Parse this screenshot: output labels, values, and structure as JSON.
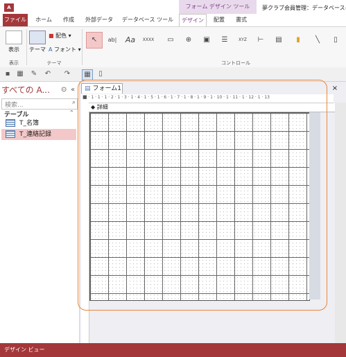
{
  "title_bar": {
    "app_icon": "A",
    "context_header": "フォーム デザイン ツール",
    "doc_title": "夢クラブ会員管理：データベース- C:"
  },
  "tabs": [
    "ファイル",
    "ホーム",
    "作成",
    "外部データ",
    "データベース ツール",
    "デザイン",
    "配置",
    "書式"
  ],
  "ribbon": {
    "group_view": {
      "button": "表示",
      "label": "表示"
    },
    "group_theme": {
      "theme_button": "テーマ",
      "colors": "配色",
      "fonts": "フォント",
      "label": "テーマ"
    },
    "group_controls": {
      "label": "コントロール",
      "text_box": "ab|",
      "label_glyph": "Aa",
      "button_glyph": "XXXX",
      "xyz": "XYZ"
    }
  },
  "nav_pane": {
    "header": "すべての A...",
    "search_placeholder": "検索...",
    "section": "テーブル",
    "items": [
      "T_名簿",
      "T_連絡記録"
    ]
  },
  "document": {
    "tab_label": "フォーム1",
    "ruler": "· 1 · 1 · 1 · 2 · 1 · 3 · 1 · 4 · 1 · 5 · 1 · 6 · 1 · 7 · 1 · 8 · 1 · 9 · 1 · 10 · 1 · 11 · 1 · 12 · 1 · 13",
    "section_label": "詳細"
  },
  "status_bar": "デザイン ビュー",
  "colors": {
    "accent": "#a4373a",
    "context": "#7a3e85",
    "highlight": "#e8873a"
  }
}
